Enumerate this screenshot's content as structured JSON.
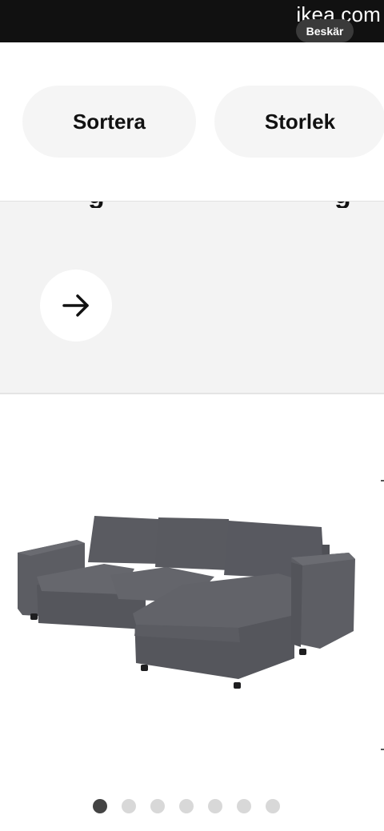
{
  "browser": {
    "domain": "ikea.com",
    "crop_label": "Beskär"
  },
  "filters": {
    "sort_label": "Sortera",
    "size_label": "Storlek"
  },
  "carousel": {
    "total": 7,
    "active_index": 0
  },
  "colors": {
    "sofa_fabric": "#5f6066",
    "button_bg": "#f5f5f5",
    "promo_bg": "#f3f3f3",
    "active_dot": "#444444",
    "inactive_dot": "#d8d8d8"
  },
  "icons": {
    "promo_button": "arrow-right-icon"
  }
}
